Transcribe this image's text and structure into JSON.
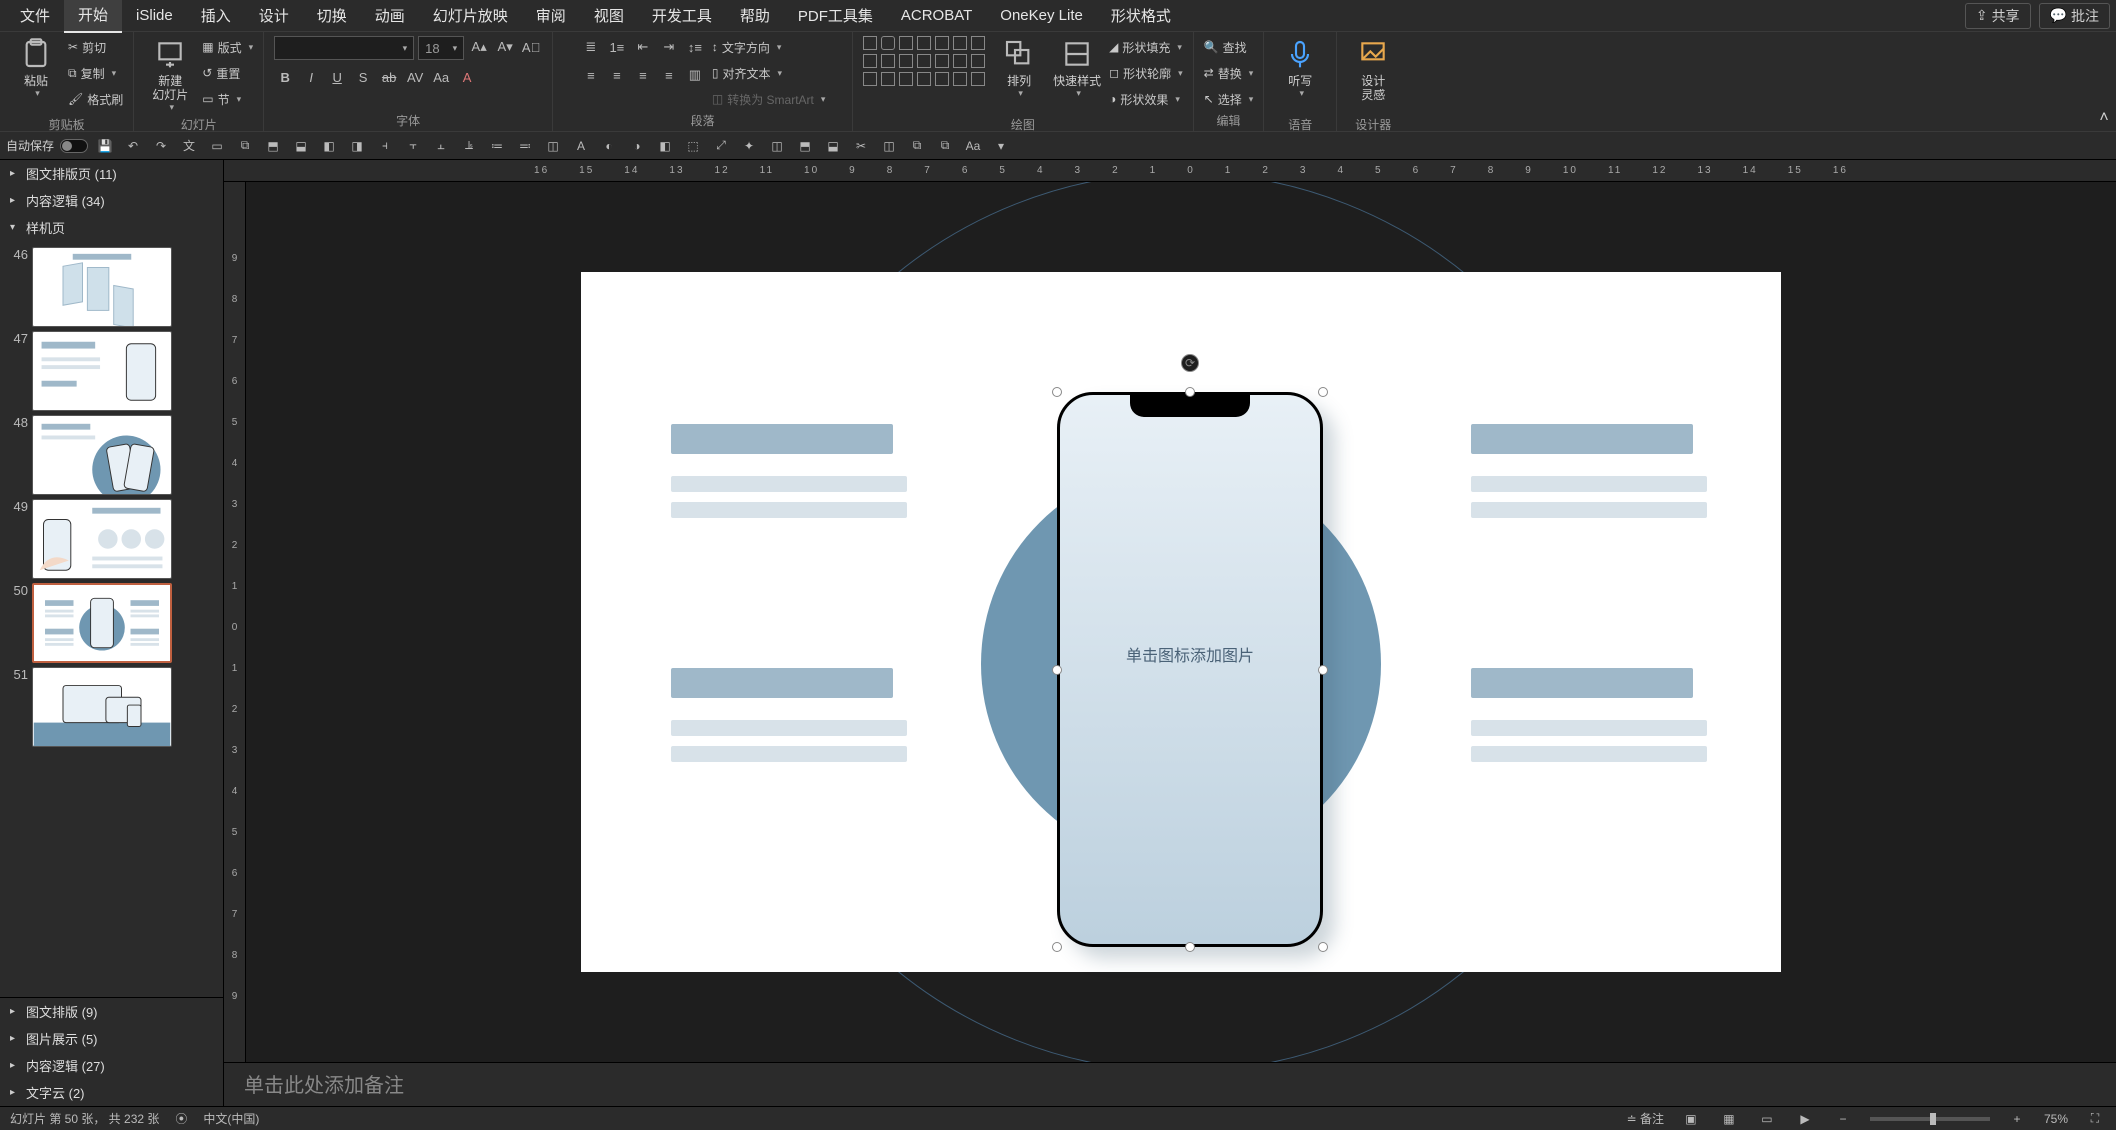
{
  "menu": {
    "items": [
      "文件",
      "开始",
      "iSlide",
      "插入",
      "设计",
      "切换",
      "动画",
      "幻灯片放映",
      "审阅",
      "视图",
      "开发工具",
      "帮助",
      "PDF工具集",
      "ACROBAT",
      "OneKey Lite",
      "形状格式"
    ],
    "active_index": 1,
    "share": "共享",
    "notes_btn": "批注"
  },
  "ribbon": {
    "groups": {
      "clipboard": "剪贴板",
      "slides": "幻灯片",
      "font": "字体",
      "paragraph": "段落",
      "drawing": "绘图",
      "editing": "编辑",
      "voice": "语音",
      "designer": "设计器"
    },
    "clipboard": {
      "paste": "粘贴",
      "cut": "剪切",
      "copy": "复制",
      "format_painter": "格式刷"
    },
    "slides": {
      "new_slide": "新建\n幻灯片",
      "layout": "版式",
      "section": "节",
      "reset": "重置"
    },
    "font": {
      "name_placeholder": "",
      "size": "18",
      "buttons": [
        "B",
        "I",
        "U",
        "S",
        "ab",
        "AV",
        "Aa",
        "A"
      ]
    },
    "paragraph": {
      "text_dir": "文字方向",
      "align_text": "对齐文本",
      "smartart": "转换为 SmartArt"
    },
    "drawing": {
      "arrange": "排列",
      "quick_styles": "快速样式",
      "shape_fill": "形状填充",
      "shape_outline": "形状轮廓",
      "shape_effects": "形状效果"
    },
    "editing": {
      "find": "查找",
      "replace": "替换",
      "select": "选择"
    },
    "voice": {
      "dictate": "听写"
    },
    "designer": {
      "label": "设计\n灵感"
    }
  },
  "quickbar": {
    "auto_save": "自动保存"
  },
  "outline": {
    "items": [
      {
        "label": "图文排版页 (11)",
        "expanded": false
      },
      {
        "label": "内容逻辑 (34)",
        "expanded": false
      },
      {
        "label": "样机页",
        "expanded": true
      },
      {
        "label": "图文排版 (9)",
        "expanded": false
      },
      {
        "label": "图片展示 (5)",
        "expanded": false
      },
      {
        "label": "内容逻辑 (27)",
        "expanded": false
      },
      {
        "label": "文字云 (2)",
        "expanded": false
      }
    ]
  },
  "thumbs": {
    "start": 46,
    "active": 50,
    "count": 6
  },
  "ruler": {
    "top": [
      "16",
      "15",
      "14",
      "13",
      "12",
      "11",
      "10",
      "9",
      "8",
      "7",
      "6",
      "5",
      "4",
      "3",
      "2",
      "1",
      "0",
      "1",
      "2",
      "3",
      "4",
      "5",
      "6",
      "7",
      "8",
      "9",
      "10",
      "11",
      "12",
      "13",
      "14",
      "15",
      "16"
    ],
    "left": [
      "9",
      "8",
      "7",
      "6",
      "5",
      "4",
      "3",
      "2",
      "1",
      "0",
      "1",
      "2",
      "3",
      "4",
      "5",
      "6",
      "7",
      "8",
      "9"
    ]
  },
  "slide": {
    "placeholder_text": "单击图标添加图片"
  },
  "notes": {
    "placeholder": "单击此处添加备注"
  },
  "status": {
    "slide_info": "幻灯片 第 50 张， 共 232 张",
    "lang": "中文(中国)",
    "notes": "备注",
    "zoom": "75%"
  }
}
